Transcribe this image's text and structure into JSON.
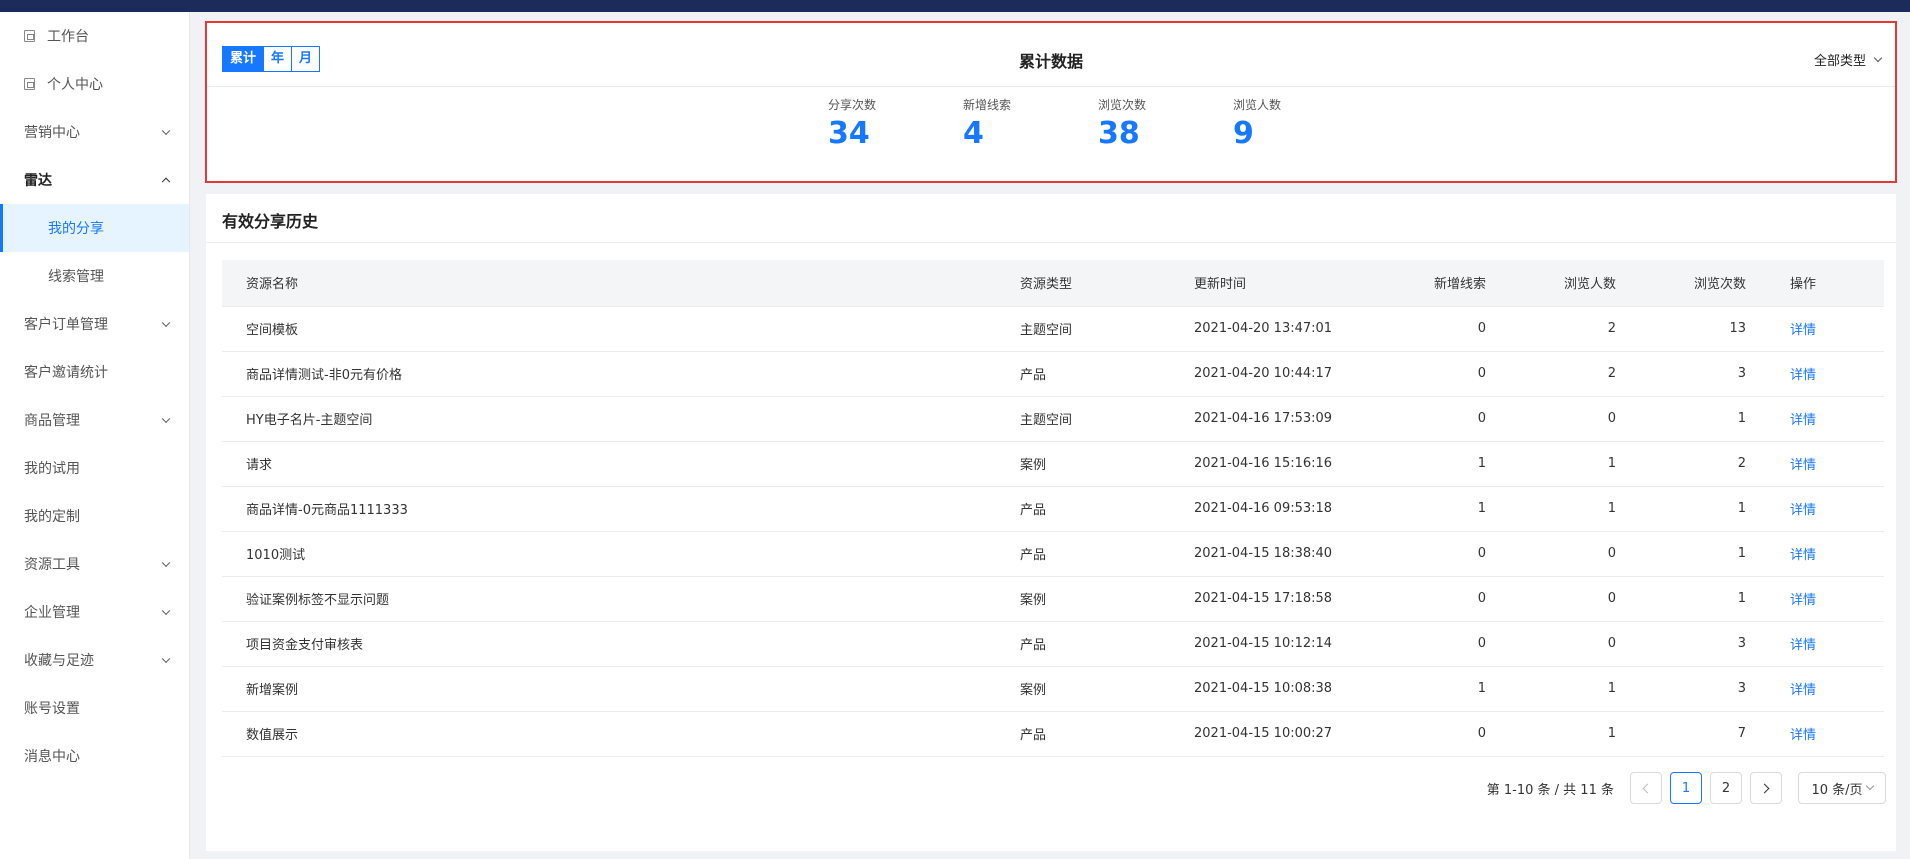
{
  "sidebar": {
    "items": [
      {
        "label": "工作台"
      },
      {
        "label": "个人中心"
      },
      {
        "label": "营销中心"
      },
      {
        "label": "雷达"
      },
      {
        "label": "我的分享"
      },
      {
        "label": "线索管理"
      },
      {
        "label": "客户订单管理"
      },
      {
        "label": "客户邀请统计"
      },
      {
        "label": "商品管理"
      },
      {
        "label": "我的试用"
      },
      {
        "label": "我的定制"
      },
      {
        "label": "资源工具"
      },
      {
        "label": "企业管理"
      },
      {
        "label": "收藏与足迹"
      },
      {
        "label": "账号设置"
      },
      {
        "label": "消息中心"
      }
    ]
  },
  "stats": {
    "title": "累计数据",
    "tabs": [
      "累计",
      "年",
      "月"
    ],
    "type_filter": "全部类型",
    "metrics": [
      {
        "label": "分享次数",
        "value": "34"
      },
      {
        "label": "新增线索",
        "value": "4"
      },
      {
        "label": "浏览次数",
        "value": "38"
      },
      {
        "label": "浏览人数",
        "value": "9"
      }
    ]
  },
  "history": {
    "title": "有效分享历史",
    "columns": [
      "资源名称",
      "资源类型",
      "更新时间",
      "新增线索",
      "浏览人数",
      "浏览次数",
      "操作"
    ],
    "rows": [
      {
        "name": "空间模板",
        "type": "主题空间",
        "time": "2021-04-20 13:47:01",
        "leads": "0",
        "visitors": "2",
        "views": "13",
        "action": "详情"
      },
      {
        "name": "商品详情测试-非0元有价格",
        "type": "产品",
        "time": "2021-04-20 10:44:17",
        "leads": "0",
        "visitors": "2",
        "views": "3",
        "action": "详情"
      },
      {
        "name": "HY电子名片-主题空间",
        "type": "主题空间",
        "time": "2021-04-16 17:53:09",
        "leads": "0",
        "visitors": "0",
        "views": "1",
        "action": "详情"
      },
      {
        "name": "请求",
        "type": "案例",
        "time": "2021-04-16 15:16:16",
        "leads": "1",
        "visitors": "1",
        "views": "2",
        "action": "详情"
      },
      {
        "name": "商品详情-0元商品1111333",
        "type": "产品",
        "time": "2021-04-16 09:53:18",
        "leads": "1",
        "visitors": "1",
        "views": "1",
        "action": "详情"
      },
      {
        "name": "1010测试",
        "type": "产品",
        "time": "2021-04-15 18:38:40",
        "leads": "0",
        "visitors": "0",
        "views": "1",
        "action": "详情"
      },
      {
        "name": "验证案例标签不显示问题",
        "type": "案例",
        "time": "2021-04-15 17:18:58",
        "leads": "0",
        "visitors": "0",
        "views": "1",
        "action": "详情"
      },
      {
        "name": "项目资金支付审核表",
        "type": "产品",
        "time": "2021-04-15 10:12:14",
        "leads": "0",
        "visitors": "0",
        "views": "3",
        "action": "详情"
      },
      {
        "name": "新增案例",
        "type": "案例",
        "time": "2021-04-15 10:08:38",
        "leads": "1",
        "visitors": "1",
        "views": "3",
        "action": "详情"
      },
      {
        "name": "数值展示",
        "type": "产品",
        "time": "2021-04-15 10:00:27",
        "leads": "0",
        "visitors": "1",
        "views": "7",
        "action": "详情"
      }
    ]
  },
  "pagination": {
    "info": "第 1-10 条 / 共 11 条",
    "pages": [
      "1",
      "2"
    ],
    "current": "1",
    "page_size": "10 条/页"
  },
  "colors": {
    "accent": "#1677ff",
    "highlight_border": "#e53935",
    "topbar": "#1d2b5a"
  }
}
